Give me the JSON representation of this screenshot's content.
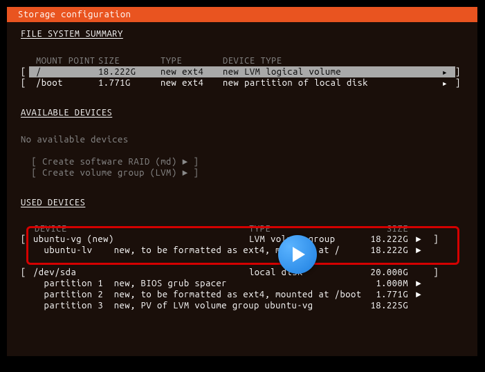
{
  "titlebar": "Storage configuration",
  "sections": {
    "file_system_summary": "FILE SYSTEM SUMMARY",
    "available_devices": "AVAILABLE DEVICES",
    "used_devices": "USED DEVICES"
  },
  "fs_headers": {
    "mount": "MOUNT POINT",
    "size": "SIZE",
    "type": "TYPE",
    "device_type": "DEVICE TYPE"
  },
  "fs_rows": [
    {
      "lb": "[",
      "mount": "/",
      "size": "18.222G",
      "type": "new ext4",
      "dtype": "new LVM logical volume",
      "selected": true,
      "rb": "]"
    },
    {
      "lb": "[",
      "mount": "/boot",
      "size": "1.771G",
      "type": "new ext4",
      "dtype": "new partition of local disk",
      "selected": false,
      "rb": "]"
    }
  ],
  "no_devices": "No available devices",
  "avail_actions": [
    "[ Create software RAID (md) ► ]",
    "[ Create volume group (LVM) ► ]"
  ],
  "used_headers": {
    "device": "DEVICE",
    "type": "TYPE",
    "size": "SIZE"
  },
  "used_group1": [
    {
      "lb": "[",
      "device": "ubuntu-vg (new)",
      "type": "LVM volume group",
      "size": "18.222G",
      "arrow": "►",
      "rb": "]"
    },
    {
      "lb": "",
      "device": "  ubuntu-lv    new, to be formatted as ext4, mounted at /",
      "type": "",
      "size": "18.222G",
      "arrow": "►",
      "rb": ""
    }
  ],
  "used_group2": [
    {
      "lb": "[",
      "device": "/dev/sda",
      "type": "local disk",
      "size": "20.000G",
      "arrow": "",
      "rb": "]"
    },
    {
      "lb": "",
      "device": "  partition 1  new, BIOS grub spacer",
      "type": "",
      "size": "1.000M",
      "arrow": "►",
      "rb": ""
    },
    {
      "lb": "",
      "device": "  partition 2  new, to be formatted as ext4, mounted at /boot",
      "type": "",
      "size": "1.771G",
      "arrow": "►",
      "rb": ""
    },
    {
      "lb": "",
      "device": "  partition 3  new, PV of LVM volume group ubuntu-vg",
      "type": "",
      "size": "18.225G",
      "arrow": "",
      "rb": ""
    }
  ]
}
